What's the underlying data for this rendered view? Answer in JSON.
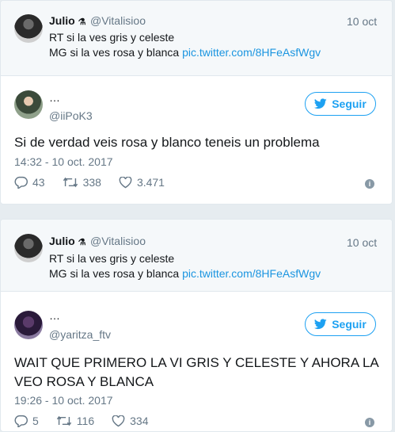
{
  "tweets": [
    {
      "reply_to": {
        "name": "Julio",
        "handle": "@Vitalisioo",
        "date": "10 oct",
        "line1": "RT si la ves gris y celeste",
        "line2_prefix": "MG si la ves rosa y blanca",
        "line2_link": "pic.twitter.com/8HFeAsfWgv"
      },
      "author": {
        "name": "…",
        "handle": "@iiPoK3"
      },
      "follow_label": "Seguir",
      "text": "Si de verdad veis rosa y blanco teneis un problema",
      "text_line2": "",
      "timestamp": "14:32 - 10 oct. 2017",
      "replies": "43",
      "retweets": "338",
      "likes": "3.471"
    },
    {
      "reply_to": {
        "name": "Julio",
        "handle": "@Vitalisioo",
        "date": "10 oct",
        "line1": "RT si la ves gris y celeste",
        "line2_prefix": "MG si la ves rosa y blanca",
        "line2_link": "pic.twitter.com/8HFeAsfWgv"
      },
      "author": {
        "name": "…",
        "handle": "@yaritza_ftv"
      },
      "follow_label": "Seguir",
      "text": "WAIT QUE PRIMERO LA VI GRIS Y CELESTE Y AHORA LA",
      "text_line2": "VEO ROSA Y BLANCA",
      "timestamp": "19:26 - 10 oct. 2017",
      "replies": "5",
      "retweets": "116",
      "likes": "334"
    }
  ],
  "colors": {
    "accent": "#1da1f2",
    "muted": "#657786",
    "link": "#1b95e0"
  },
  "icons": [
    "reply-icon",
    "retweet-icon",
    "heart-icon",
    "info-icon",
    "twitter-bird-icon"
  ]
}
